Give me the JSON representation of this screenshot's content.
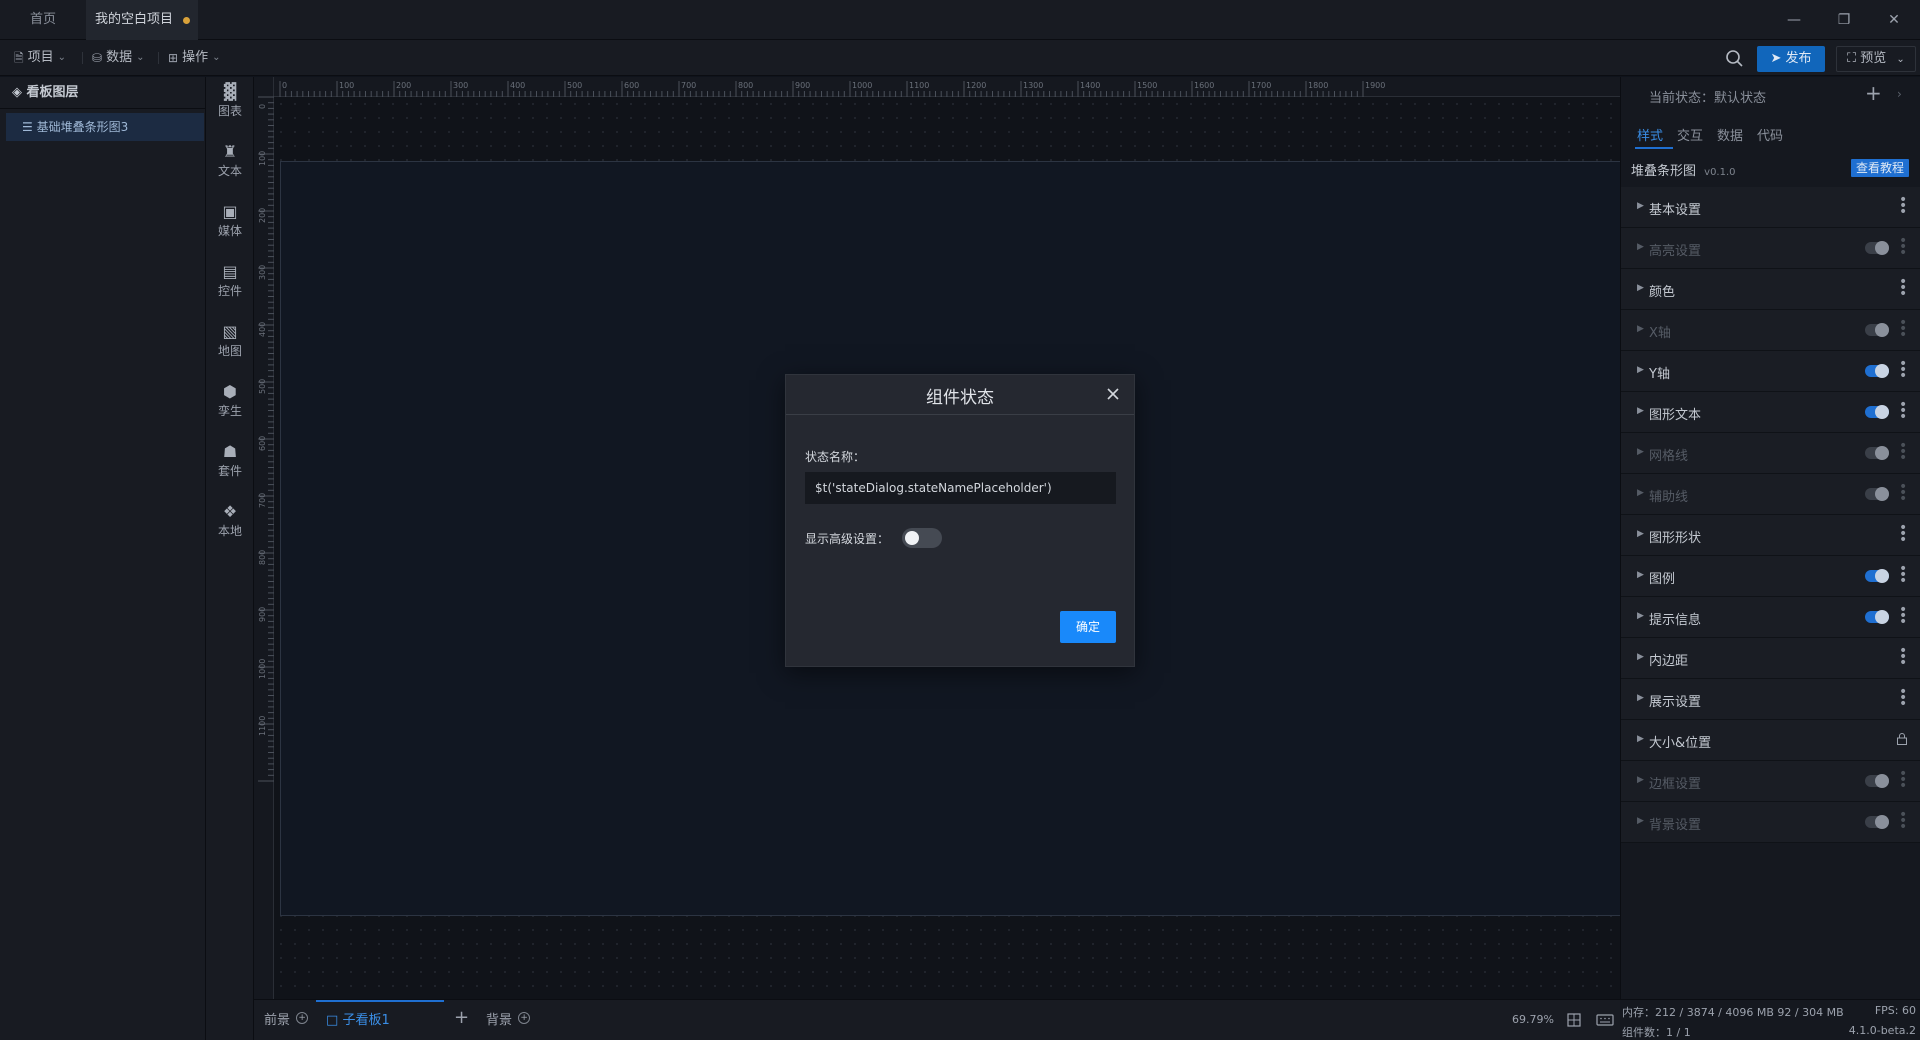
{
  "tabs": {
    "home": "首页",
    "project": "我的空白项目"
  },
  "menu": {
    "project": "项目",
    "data": "数据",
    "operation": "操作"
  },
  "toolbar": {
    "publish": "发布",
    "preview": "预览"
  },
  "layers": {
    "title": "看板图层",
    "items": [
      "基础堆叠条形图3"
    ]
  },
  "tools": [
    {
      "label": "图表",
      "icon": "bar-chart-icon"
    },
    {
      "label": "文本",
      "icon": "text-icon"
    },
    {
      "label": "媒体",
      "icon": "media-icon"
    },
    {
      "label": "控件",
      "icon": "widget-icon"
    },
    {
      "label": "地图",
      "icon": "map-icon"
    },
    {
      "label": "孪生",
      "icon": "digital-twin-icon"
    },
    {
      "label": "套件",
      "icon": "kit-icon"
    },
    {
      "label": "本地",
      "icon": "local-icon"
    }
  ],
  "ruler": {
    "h_labels": [
      "0",
      "100",
      "200",
      "300",
      "400",
      "500",
      "600",
      "700",
      "800",
      "900",
      "1000",
      "1100",
      "1200",
      "1300",
      "1400",
      "1500",
      "1600",
      "1700",
      "1800",
      "1900"
    ],
    "v_labels": [
      "0",
      "100",
      "200",
      "300",
      "400",
      "500",
      "600",
      "700",
      "800",
      "900",
      "1000",
      "1100"
    ]
  },
  "bottom": {
    "foreground": "前景",
    "sub_board": "子看板1",
    "background": "背景",
    "zoom": "69.79%"
  },
  "right_panel": {
    "current_state": "当前状态：默认状态",
    "tabs": [
      "样式",
      "交互",
      "数据",
      "代码"
    ],
    "component_name": "堆叠条形图",
    "version": "v0.1.0",
    "tutorial": "查看教程",
    "sections": [
      {
        "label": "基本设置",
        "control": "dots",
        "dim": false
      },
      {
        "label": "高亮设置",
        "control": "toggle-off",
        "dim": true
      },
      {
        "label": "颜色",
        "control": "dots",
        "dim": false
      },
      {
        "label": "X轴",
        "control": "toggle-off",
        "dim": true
      },
      {
        "label": "Y轴",
        "control": "toggle-on",
        "dim": false
      },
      {
        "label": "图形文本",
        "control": "toggle-on",
        "dim": false
      },
      {
        "label": "网格线",
        "control": "toggle-off",
        "dim": true
      },
      {
        "label": "辅助线",
        "control": "toggle-off",
        "dim": true
      },
      {
        "label": "图形形状",
        "control": "dots",
        "dim": false
      },
      {
        "label": "图例",
        "control": "toggle-on",
        "dim": false
      },
      {
        "label": "提示信息",
        "control": "toggle-on",
        "dim": false
      },
      {
        "label": "内边距",
        "control": "dots",
        "dim": false
      },
      {
        "label": "展示设置",
        "control": "dots",
        "dim": false
      },
      {
        "label": "大小&位置",
        "control": "lock",
        "dim": false
      },
      {
        "label": "边框设置",
        "control": "toggle-off",
        "dim": true
      },
      {
        "label": "背景设置",
        "control": "toggle-off",
        "dim": true
      }
    ]
  },
  "status": {
    "memory": "内存：212 / 3874 / 4096 MB  92 / 304 MB",
    "fps": "FPS: 60",
    "count": "组件数：1 / 1",
    "version": "4.1.0-beta.2"
  },
  "dialog": {
    "title": "组件状态",
    "name_label": "状态名称：",
    "name_value": "$t('stateDialog.stateNamePlaceholder')",
    "advanced_label": "显示高级设置：",
    "ok": "确定"
  },
  "colors": {
    "accent": "#1989fa",
    "publish": "#1166bb",
    "modified_dot": "#d9a23a"
  }
}
